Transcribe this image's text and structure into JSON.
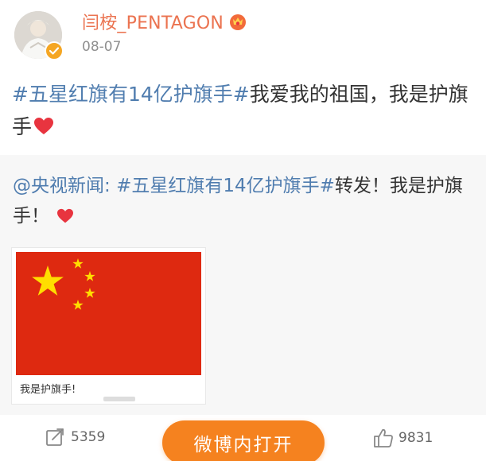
{
  "header": {
    "username": "闫桉_PENTAGON",
    "time": "08-07"
  },
  "post": {
    "hashtag": "#五星红旗有14亿护旗手#",
    "text": "我爱我的祖国，我是护旗手"
  },
  "repost": {
    "mention": "@央视新闻:",
    "hashtag": "#五星红旗有14亿护旗手#",
    "text": "转发！我是护旗手！",
    "image_caption": "我是护旗手!"
  },
  "actions": {
    "repost_count": "5359",
    "open_app_label": "微博内打开",
    "like_count": "9831"
  },
  "colors": {
    "username": "#eb7350",
    "link": "#507daf",
    "button": "#f5821f",
    "heart": "#e8343f",
    "flag_red": "#de2910",
    "flag_star": "#ffde00"
  },
  "icons": {
    "verified": "verified-badge-icon",
    "vip": "vip-crown-icon",
    "heart": "heart-icon",
    "repost": "repost-icon",
    "like": "thumbs-up-icon"
  }
}
